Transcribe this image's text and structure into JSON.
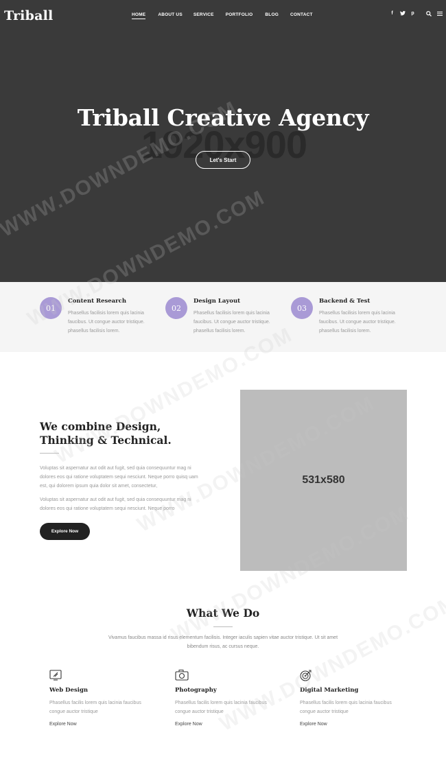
{
  "header": {
    "logo": "Triball",
    "nav": [
      "HOME",
      "ABOUT US",
      "SERVICE",
      "PORTFOLIO",
      "BLOG",
      "CONTACT"
    ],
    "social": [
      "f",
      "t",
      "p"
    ],
    "tool_icons": [
      "search-icon",
      "menu-icon"
    ]
  },
  "hero": {
    "title": "Triball Creative Agency",
    "placeholder_size": "1920x900",
    "button": "Let's Start",
    "background": "#3a3a3a"
  },
  "features": [
    {
      "num": "01",
      "title": "Content Research",
      "text": "Phasellus facilisis lorem quis lacinia faucibus. Ut congue auctor tristique. phasellus facilisis lorem."
    },
    {
      "num": "02",
      "title": "Design Layout",
      "text": "Phasellus facilisis lorem quis lacinia faucibus. Ut congue auctor tristique. phasellus facilisis lorem."
    },
    {
      "num": "03",
      "title": "Backend & Test",
      "text": "Phasellus facilisis lorem quis lacinia faucibus. Ut congue auctor tristique. phasellus facilisis lorem."
    }
  ],
  "about": {
    "title": "We combine Design, Thinking & Technical.",
    "p1": "Voluptas sit aspernatur aut odit aut fugit, sed quia consequuntur mag ni dolores eos qui ratione voluptatem sequi nesciunt. Neque porro quisq uam est, qui dolorem ipsum quia dolor sit amet, consectetur,",
    "p2": "Voluptas sit aspernatur aut odit aut fugit, sed quia consequuntur mag ni dolores eos qui ratione voluptatem sequi nesciunt. Neque porro",
    "button": "Explore Now",
    "image_size": "531x580"
  },
  "what_we_do": {
    "title": "What We Do",
    "desc": "Vivamus faucibus massa id risus elementum facilisis. Integer iaculis sapien vitae auctor tristique. Ut sit amet bibendum risus, ac cursus neque.",
    "services": [
      {
        "icon": "web-design-icon",
        "title": "Web Design",
        "text": "Phasellus facilis lorem quis lacinia faucibus congue auctor tristique",
        "link": "Explore Now"
      },
      {
        "icon": "camera-icon",
        "title": "Photography",
        "text": "Phasellus facilis lorem quis lacinia faucibus congue auctor tristique",
        "link": "Explore Now"
      },
      {
        "icon": "target-icon",
        "title": "Digital Marketing",
        "text": "Phasellus facilis lorem quis lacinia faucibus congue auctor tristique",
        "link": "Explore Now"
      }
    ]
  },
  "watermark": "WWW.DOWNDEMO.COM",
  "colors": {
    "accent": "#a99ad6",
    "dark": "#222222",
    "hero": "#3a3a3a"
  }
}
